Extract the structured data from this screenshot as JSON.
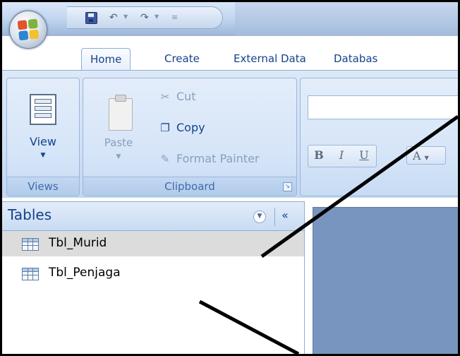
{
  "ribbon": {
    "tabs": [
      "Home",
      "Create",
      "External Data",
      "Databas"
    ],
    "views": {
      "view_label": "View",
      "group_label": "Views"
    },
    "clipboard": {
      "paste_label": "Paste",
      "cut_label": "Cut",
      "copy_label": "Copy",
      "format_painter_label": "Format Painter",
      "group_label": "Clipboard"
    },
    "font": {
      "bold": "B",
      "italic": "I",
      "underline": "U",
      "font_color": "A"
    }
  },
  "navigation_pane": {
    "title": "Tables",
    "items": [
      "Tbl_Murid",
      "Tbl_Penjaga"
    ],
    "selected_item": "Tbl_Murid"
  },
  "icons": {
    "office_button": "office-logo-icon",
    "save": "save-icon",
    "undo": "undo-icon",
    "redo": "redo-icon",
    "view": "view-icon",
    "paste": "paste-icon",
    "cut": "scissors-icon",
    "copy": "copy-icon",
    "format_painter": "brush-icon",
    "table": "table-icon"
  },
  "colors": {
    "ribbon_text": "#15428b",
    "ribbon_bg": "#cfe0f5",
    "workspace": "#7895bf",
    "selected_row": "#dcdcdc"
  }
}
